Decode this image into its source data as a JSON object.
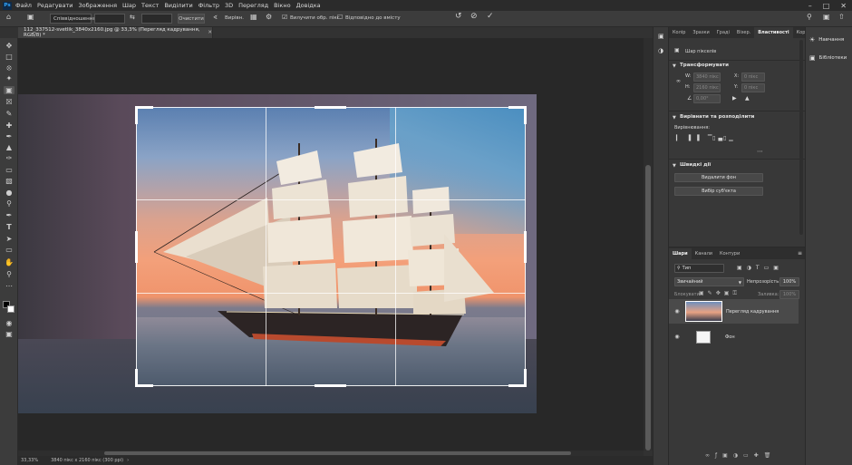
{
  "app": {
    "logo": "Ps"
  },
  "menu": [
    "Файл",
    "Редагувати",
    "Зображення",
    "Шар",
    "Текст",
    "Виділити",
    "Фільтр",
    "3D",
    "Перегляд",
    "Вікно",
    "Довідка"
  ],
  "options": {
    "ratio": "Співвідношення",
    "clear": "Очистити",
    "straighten": "Вирівн.",
    "delete_cropped": "Вилучити обр. пікс.",
    "content_aware": "Відповідно до вмісту"
  },
  "document": {
    "tab_title": "112_337512-svetlik_3840x2160.jpg @ 33,3% (Перегляд кадрування, RGB/8) *"
  },
  "status": {
    "zoom": "33,33%",
    "info": "3840 пікс x 2160 пікс (300 ppi)"
  },
  "properties_panel": {
    "tabs": [
      "Колір",
      "Зразки",
      "Граді",
      "Візер.",
      "Властивості",
      "Корек"
    ],
    "active_tab": "Властивості",
    "layer_kind": "Шар пікселів",
    "transform_title": "Трансформувати",
    "w_label": "W:",
    "h_label": "H:",
    "x_label": "X:",
    "y_label": "Y:",
    "w_value": "3840 пікс",
    "h_value": "2160 пікс",
    "x_value": "0 пікс",
    "y_value": "0 пікс",
    "angle_value": "0,00°",
    "align_title": "Вирівнати та розподілити",
    "align_label": "Вирівнювання:",
    "quick_title": "Швидкі дії",
    "remove_bg": "Видалити фон",
    "select_subject": "Вибір суб'єкта"
  },
  "layers_panel": {
    "tabs": [
      "Шари",
      "Канали",
      "Контури"
    ],
    "active_tab": "Шари",
    "kind_label": "Тип",
    "blend_mode": "Звичайний",
    "opacity_label": "Непрозорість:",
    "opacity_value": "100%",
    "lock_label": "Блокувати:",
    "fill_label": "Заливка:",
    "fill_value": "100%",
    "layers": [
      {
        "name": "Перегляд кадрування"
      },
      {
        "name": "Фон"
      }
    ]
  },
  "right_bar": {
    "learn": "Навчання",
    "libraries": "Бібліотеки"
  },
  "colors": {
    "accent": "#31a8ff",
    "menubar_bg": "#2b2b2b",
    "panel_bg": "#383838"
  }
}
